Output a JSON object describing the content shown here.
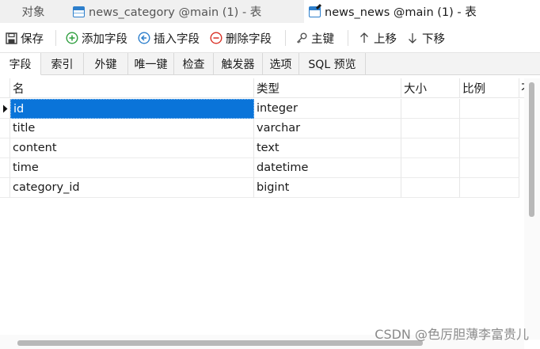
{
  "window_tabs": [
    {
      "label": "对象",
      "icon": "none",
      "active": false
    },
    {
      "label": "news_category @main (1) - 表",
      "icon": "table-icon",
      "active": false
    },
    {
      "label": "news_news @main (1) - 表",
      "icon": "table-edit-icon",
      "active": true
    }
  ],
  "toolbar": {
    "save": "保存",
    "add_field": "添加字段",
    "insert_field": "插入字段",
    "delete_field": "删除字段",
    "primary_key": "主键",
    "move_up": "上移",
    "move_down": "下移"
  },
  "subtabs": [
    "字段",
    "索引",
    "外键",
    "唯一键",
    "检查",
    "触发器",
    "选项",
    "SQL 预览"
  ],
  "active_subtab": "字段",
  "grid": {
    "columns": {
      "name": "名",
      "type": "类型",
      "size": "大小",
      "scale": "比例",
      "extra": "不"
    },
    "rows": [
      {
        "name": "id",
        "type": "integer",
        "size": "",
        "scale": ""
      },
      {
        "name": "title",
        "type": "varchar",
        "size": "",
        "scale": ""
      },
      {
        "name": "content",
        "type": "text",
        "size": "",
        "scale": ""
      },
      {
        "name": "time",
        "type": "datetime",
        "size": "",
        "scale": ""
      },
      {
        "name": "category_id",
        "type": "bigint",
        "size": "",
        "scale": ""
      }
    ],
    "selected_row": 0
  },
  "watermark": "CSDN @色厉胆薄李富贵儿",
  "colors": {
    "selection": "#0a74d9",
    "accent": "#2d7fcc",
    "add_icon": "#2e9e3e",
    "delete_icon": "#d93025"
  }
}
